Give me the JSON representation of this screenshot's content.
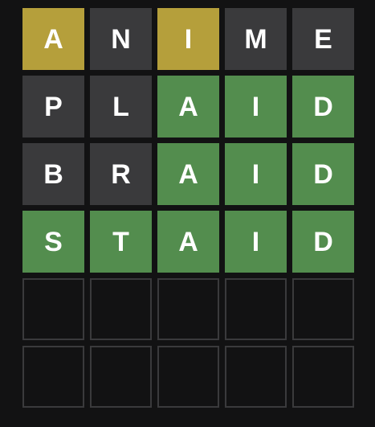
{
  "board": {
    "rows": [
      [
        {
          "letter": "A",
          "state": "present"
        },
        {
          "letter": "N",
          "state": "absent"
        },
        {
          "letter": "I",
          "state": "present"
        },
        {
          "letter": "M",
          "state": "absent"
        },
        {
          "letter": "E",
          "state": "absent"
        }
      ],
      [
        {
          "letter": "P",
          "state": "absent"
        },
        {
          "letter": "L",
          "state": "absent"
        },
        {
          "letter": "A",
          "state": "correct"
        },
        {
          "letter": "I",
          "state": "correct"
        },
        {
          "letter": "D",
          "state": "correct"
        }
      ],
      [
        {
          "letter": "B",
          "state": "absent"
        },
        {
          "letter": "R",
          "state": "absent"
        },
        {
          "letter": "A",
          "state": "correct"
        },
        {
          "letter": "I",
          "state": "correct"
        },
        {
          "letter": "D",
          "state": "correct"
        }
      ],
      [
        {
          "letter": "S",
          "state": "correct"
        },
        {
          "letter": "T",
          "state": "correct"
        },
        {
          "letter": "A",
          "state": "correct"
        },
        {
          "letter": "I",
          "state": "correct"
        },
        {
          "letter": "D",
          "state": "correct"
        }
      ],
      [
        {
          "letter": "",
          "state": "empty"
        },
        {
          "letter": "",
          "state": "empty"
        },
        {
          "letter": "",
          "state": "empty"
        },
        {
          "letter": "",
          "state": "empty"
        },
        {
          "letter": "",
          "state": "empty"
        }
      ],
      [
        {
          "letter": "",
          "state": "empty"
        },
        {
          "letter": "",
          "state": "empty"
        },
        {
          "letter": "",
          "state": "empty"
        },
        {
          "letter": "",
          "state": "empty"
        },
        {
          "letter": "",
          "state": "empty"
        }
      ]
    ]
  },
  "colors": {
    "background": "#121213",
    "correct": "#538d4e",
    "present": "#b59f3b",
    "absent": "#3a3a3c",
    "empty_border": "#3a3a3c",
    "text": "#ffffff"
  }
}
